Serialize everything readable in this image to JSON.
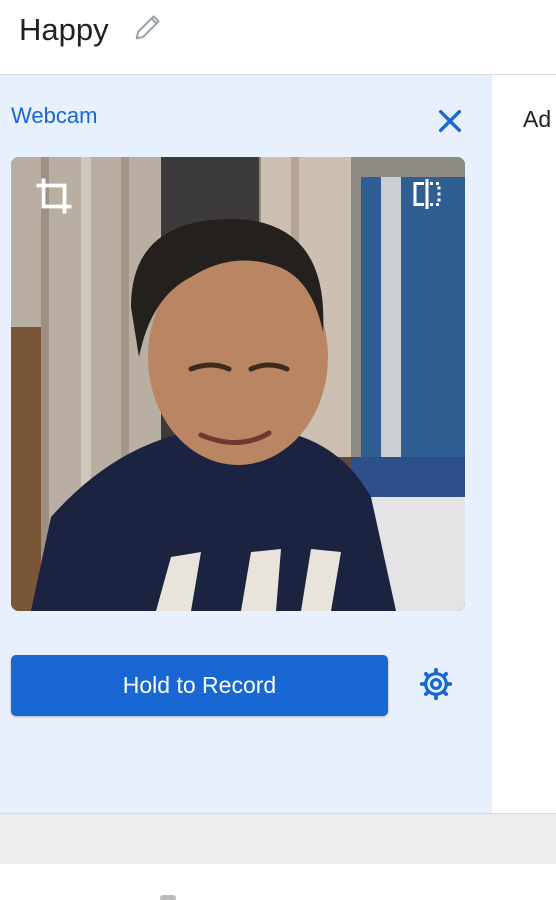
{
  "header": {
    "title": "Happy",
    "edit_icon": "pencil-icon"
  },
  "webcam_panel": {
    "label": "Webcam",
    "close_icon": "close-icon",
    "preview": {
      "crop_icon": "crop-icon",
      "flip_icon": "flip-horizontal-icon"
    },
    "record_button_label": "Hold to Record",
    "settings_icon": "gear-icon"
  },
  "right_pane": {
    "label": "Ad"
  },
  "colors": {
    "accent": "#1967d2",
    "panel_bg": "#e8f0fe",
    "divider_strip": "#ecedef"
  }
}
